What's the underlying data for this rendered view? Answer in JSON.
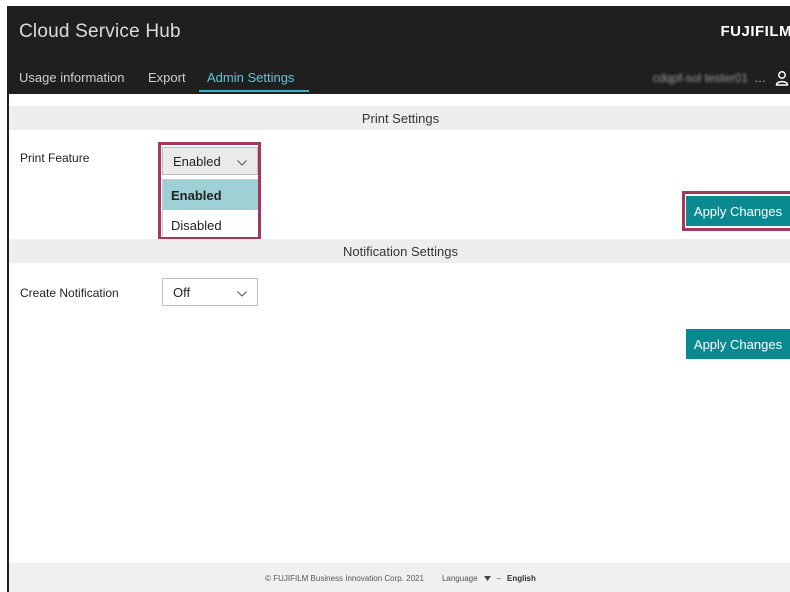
{
  "header": {
    "app_title": "Cloud Service Hub",
    "brand": "FUJIFILM",
    "user_name": "cdqpf-sol tester01",
    "user_ellipsis": "…",
    "user_icon": "person-icon"
  },
  "nav": {
    "tabs": [
      {
        "label": "Usage information",
        "active": false
      },
      {
        "label": "Export",
        "active": false
      },
      {
        "label": "Admin Settings",
        "active": true
      }
    ]
  },
  "print_settings": {
    "section_title": "Print Settings",
    "label": "Print Feature",
    "selected": "Enabled",
    "options": [
      "Enabled",
      "Disabled"
    ],
    "highlighted_option": "Enabled",
    "apply_label": "Apply Changes"
  },
  "notification_settings": {
    "section_title": "Notification Settings",
    "label": "Create Notification",
    "selected": "Off",
    "apply_label": "Apply Changes"
  },
  "footer": {
    "copyright": "© FUJIFILM Business Innovation Corp. 2021",
    "language_label": "Language",
    "separator": "–",
    "language_value": "English"
  },
  "colors": {
    "header_bg": "#1f1f1f",
    "accent": "#3fb3c4",
    "button": "#0a8a90",
    "highlight_border": "#a3375d",
    "dropdown_selected": "#9fd0d6"
  }
}
